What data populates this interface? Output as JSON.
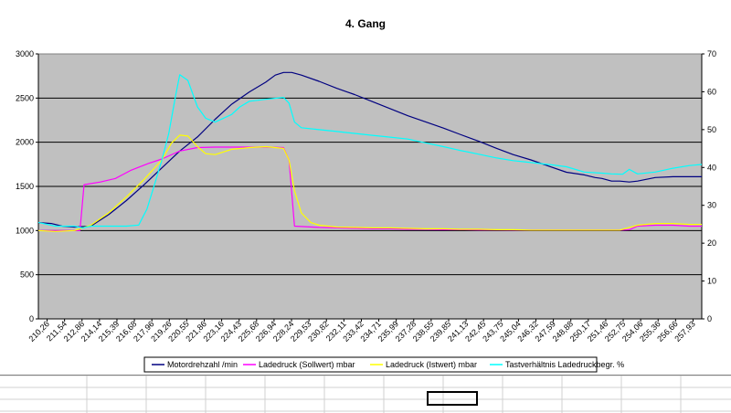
{
  "chart_data": {
    "type": "line",
    "title": "4. Gang",
    "grid": true,
    "legend_position": "bottom",
    "plot_background": "#c0c0c0",
    "y_left": {
      "min": 0,
      "max": 3000,
      "ticks": [
        "0",
        "500",
        "1000",
        "1500",
        "2000",
        "2500",
        "3000"
      ]
    },
    "y_right": {
      "min": 0,
      "max": 70,
      "ticks": [
        "0",
        "10",
        "20",
        "30",
        "40",
        "50",
        "60",
        "70"
      ]
    },
    "x_range": [
      210.26,
      258.8
    ],
    "x_tick_labels": [
      "210,26",
      "211,54",
      "212,86",
      "214,14",
      "215,39",
      "216,68",
      "217,96",
      "219,26",
      "220,55",
      "221,86",
      "223,16",
      "224,43",
      "225,68",
      "226,94",
      "228,24",
      "229,53",
      "230,82",
      "232,11",
      "233,42",
      "234,71",
      "235,99",
      "237,28",
      "238,55",
      "239,85",
      "241,13",
      "242,45",
      "243,75",
      "245,04",
      "246,32",
      "247,59",
      "248,88",
      "250,17",
      "251,46",
      "252,75",
      "254,06",
      "255,36",
      "256,66",
      "257,93"
    ],
    "series": [
      {
        "name": "Motordrehzahl  /min",
        "color": "#000080",
        "axis": "left",
        "points": [
          [
            210.26,
            1090
          ],
          [
            211.2,
            1080
          ],
          [
            212.0,
            1050
          ],
          [
            212.9,
            1040
          ],
          [
            214.1,
            1050
          ],
          [
            215.4,
            1180
          ],
          [
            216.7,
            1340
          ],
          [
            218.0,
            1520
          ],
          [
            219.3,
            1710
          ],
          [
            220.6,
            1900
          ],
          [
            221.9,
            2060
          ],
          [
            223.2,
            2260
          ],
          [
            224.4,
            2430
          ],
          [
            225.7,
            2570
          ],
          [
            226.9,
            2680
          ],
          [
            227.6,
            2760
          ],
          [
            228.2,
            2790
          ],
          [
            228.8,
            2790
          ],
          [
            229.5,
            2760
          ],
          [
            230.8,
            2690
          ],
          [
            232.1,
            2610
          ],
          [
            233.4,
            2540
          ],
          [
            234.7,
            2460
          ],
          [
            236.0,
            2380
          ],
          [
            237.3,
            2300
          ],
          [
            238.6,
            2230
          ],
          [
            239.9,
            2160
          ],
          [
            241.1,
            2090
          ],
          [
            242.5,
            2010
          ],
          [
            243.8,
            1930
          ],
          [
            245.0,
            1860
          ],
          [
            246.3,
            1800
          ],
          [
            247.6,
            1730
          ],
          [
            248.9,
            1660
          ],
          [
            250.2,
            1630
          ],
          [
            251.0,
            1600
          ],
          [
            251.5,
            1590
          ],
          [
            252.2,
            1560
          ],
          [
            252.8,
            1560
          ],
          [
            253.5,
            1550
          ],
          [
            254.1,
            1560
          ],
          [
            255.4,
            1600
          ],
          [
            256.7,
            1610
          ],
          [
            257.9,
            1610
          ],
          [
            258.8,
            1610
          ]
        ]
      },
      {
        "name": "Ladedruck (Sollwert)  mbar",
        "color": "#ff00ff",
        "axis": "left",
        "points": [
          [
            210.26,
            1000
          ],
          [
            211.5,
            1000
          ],
          [
            212.9,
            1000
          ],
          [
            213.3,
            1000
          ],
          [
            213.6,
            1520
          ],
          [
            214.8,
            1550
          ],
          [
            215.9,
            1590
          ],
          [
            217.0,
            1680
          ],
          [
            218.3,
            1760
          ],
          [
            219.3,
            1810
          ],
          [
            220.6,
            1900
          ],
          [
            221.9,
            1940
          ],
          [
            223.2,
            1945
          ],
          [
            224.4,
            1945
          ],
          [
            225.7,
            1945
          ],
          [
            226.9,
            1945
          ],
          [
            228.2,
            1940
          ],
          [
            228.6,
            1800
          ],
          [
            229.0,
            1050
          ],
          [
            230.8,
            1035
          ],
          [
            232.1,
            1030
          ],
          [
            233.4,
            1025
          ],
          [
            234.7,
            1020
          ],
          [
            236.0,
            1020
          ],
          [
            237.3,
            1015
          ],
          [
            238.6,
            1015
          ],
          [
            239.9,
            1010
          ],
          [
            241.1,
            1010
          ],
          [
            242.5,
            1008
          ],
          [
            243.8,
            1008
          ],
          [
            245.0,
            1006
          ],
          [
            246.3,
            1005
          ],
          [
            247.6,
            1005
          ],
          [
            248.9,
            1005
          ],
          [
            250.2,
            1005
          ],
          [
            251.5,
            1005
          ],
          [
            252.8,
            1005
          ],
          [
            253.5,
            1010
          ],
          [
            254.1,
            1050
          ],
          [
            255.4,
            1060
          ],
          [
            256.7,
            1060
          ],
          [
            257.9,
            1050
          ],
          [
            258.8,
            1050
          ]
        ]
      },
      {
        "name": "Ladedruck (Istwert)  mbar",
        "color": "#ffff00",
        "axis": "left",
        "points": [
          [
            210.26,
            1000
          ],
          [
            211.5,
            990
          ],
          [
            212.9,
            1000
          ],
          [
            214.1,
            1060
          ],
          [
            215.4,
            1200
          ],
          [
            216.7,
            1380
          ],
          [
            218.0,
            1580
          ],
          [
            219.3,
            1800
          ],
          [
            220.0,
            1990
          ],
          [
            220.6,
            2080
          ],
          [
            221.2,
            2070
          ],
          [
            221.9,
            1950
          ],
          [
            222.5,
            1870
          ],
          [
            223.2,
            1860
          ],
          [
            224.4,
            1920
          ],
          [
            225.7,
            1940
          ],
          [
            226.9,
            1950
          ],
          [
            228.2,
            1930
          ],
          [
            228.6,
            1800
          ],
          [
            229.0,
            1450
          ],
          [
            229.5,
            1200
          ],
          [
            230.2,
            1090
          ],
          [
            230.8,
            1060
          ],
          [
            232.1,
            1040
          ],
          [
            233.4,
            1035
          ],
          [
            234.7,
            1030
          ],
          [
            236.0,
            1030
          ],
          [
            237.3,
            1025
          ],
          [
            238.6,
            1020
          ],
          [
            239.9,
            1020
          ],
          [
            241.1,
            1015
          ],
          [
            242.5,
            1015
          ],
          [
            243.8,
            1010
          ],
          [
            245.0,
            1010
          ],
          [
            246.3,
            1005
          ],
          [
            247.6,
            1005
          ],
          [
            248.9,
            1005
          ],
          [
            250.2,
            1005
          ],
          [
            251.5,
            1005
          ],
          [
            252.8,
            1005
          ],
          [
            254.1,
            1060
          ],
          [
            255.4,
            1080
          ],
          [
            256.7,
            1080
          ],
          [
            257.9,
            1070
          ],
          [
            258.8,
            1070
          ]
        ]
      },
      {
        "name": "Tastverhältnis Ladedruckbegr.  %",
        "color": "#00ffff",
        "axis": "right",
        "points": [
          [
            210.26,
            25.5
          ],
          [
            211.5,
            24.5
          ],
          [
            212.9,
            24.5
          ],
          [
            213.5,
            24.0
          ],
          [
            214.1,
            24.5
          ],
          [
            215.4,
            24.5
          ],
          [
            216.7,
            24.5
          ],
          [
            217.6,
            24.8
          ],
          [
            218.2,
            29
          ],
          [
            218.8,
            36
          ],
          [
            219.3,
            42
          ],
          [
            219.8,
            49
          ],
          [
            220.3,
            59
          ],
          [
            220.6,
            64.5
          ],
          [
            221.2,
            63
          ],
          [
            221.9,
            56
          ],
          [
            222.5,
            53
          ],
          [
            223.2,
            52
          ],
          [
            224.4,
            54
          ],
          [
            225.0,
            56
          ],
          [
            225.7,
            57.5
          ],
          [
            226.9,
            58
          ],
          [
            228.2,
            58.5
          ],
          [
            228.6,
            57
          ],
          [
            229.0,
            52
          ],
          [
            229.5,
            50.5
          ],
          [
            230.8,
            50
          ],
          [
            232.1,
            49.5
          ],
          [
            233.4,
            49
          ],
          [
            234.7,
            48.5
          ],
          [
            236.0,
            48
          ],
          [
            237.3,
            47.5
          ],
          [
            238.6,
            46.5
          ],
          [
            239.9,
            45.5
          ],
          [
            241.1,
            44.5
          ],
          [
            242.5,
            43.5
          ],
          [
            243.8,
            42.5
          ],
          [
            245.0,
            41.8
          ],
          [
            246.3,
            41.3
          ],
          [
            247.6,
            40.8
          ],
          [
            248.9,
            40.2
          ],
          [
            250.2,
            38.8
          ],
          [
            251.5,
            38.5
          ],
          [
            252.2,
            38.3
          ],
          [
            253.0,
            38.2
          ],
          [
            253.5,
            39.5
          ],
          [
            254.1,
            38.3
          ],
          [
            255.4,
            38.8
          ],
          [
            256.7,
            39.8
          ],
          [
            257.9,
            40.5
          ],
          [
            258.8,
            40.8
          ]
        ]
      }
    ]
  }
}
